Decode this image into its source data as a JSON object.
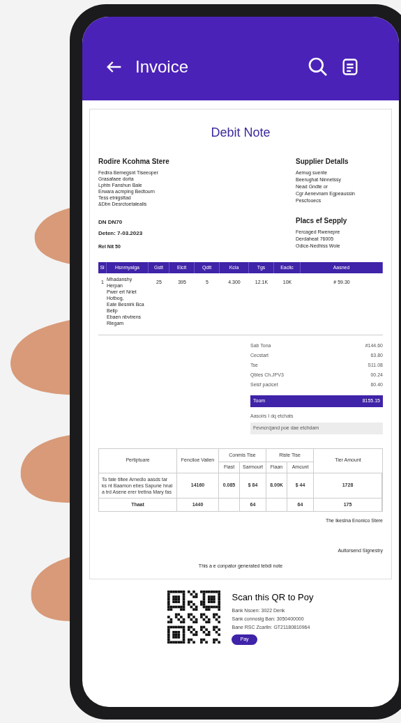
{
  "app_bar": {
    "title": "Invoice"
  },
  "document": {
    "title": "Debit Note",
    "buyer": {
      "name": "Rodire Kcohma Stere",
      "lines": [
        "Fedira Bemegsnt Tiseeoper",
        "Grasafaee dorta",
        "Lphtn Fanshun Bale",
        "Erwara acmping Bedtourn",
        "Tess etnigsttad",
        "&Dbn Desrctoetalealis"
      ]
    },
    "note_number": "DN DN70",
    "date": "Deten: 7-03.2023",
    "ref": "Rel Nit 50",
    "supplier": {
      "heading": "Supplier Detalls",
      "lines": [
        "Aemug suente",
        "Beerughat Ninnetssy",
        "Nead Gndte or",
        "Cgr Aenevnam Egpeaussin",
        "Pescfooecs"
      ]
    },
    "supply_place": {
      "heading": "Placs ef Sepply",
      "lines": [
        "Fercaged Rwenepre",
        "Derdaheat 76005",
        "Odice-Nedhiss Wole"
      ]
    },
    "items": {
      "columns": [
        "Sl",
        "Hsnmyalga",
        "Gstt",
        "Elcit",
        "Qdtt",
        "Kcia",
        "Tgs",
        "Eaclic",
        "Aasned"
      ],
      "rows": [
        {
          "cells": [
            "1",
            "",
            "25",
            "395",
            "5",
            "4.300",
            "12.1K",
            "10K",
            "# 59.30"
          ],
          "description": [
            "Mhadanshy",
            "Herpan",
            "Pwer ert Nriet",
            "Hotbog,",
            "Eate Besnirk Bca",
            "Bellp",
            "Ebaen nbvtrens",
            "Rlegam"
          ]
        }
      ]
    },
    "totals": [
      {
        "label": "Sab Tona",
        "value": "#144.60"
      },
      {
        "label": "Cecstart",
        "value": "63.80"
      },
      {
        "label": "Tse",
        "value": "S11.08"
      },
      {
        "label": "Qbles Ch.JPV3",
        "value": "00.24"
      },
      {
        "label": "Seisf pacicet",
        "value": "60.40"
      }
    ],
    "grand_total": {
      "label": "Toom",
      "value": "8155.15"
    },
    "amount_words_label": "Aasoirs I dq etchats",
    "amount_words": "Fevncrcjand poe dae etchdam",
    "tax_table": {
      "particulars": "Pertiptuare",
      "taxable": "Fenciloe Valien",
      "group_1": "Conmis Tise",
      "group_2": "Riste Tise",
      "sub": [
        "Fiast",
        "Sarmourt",
        "Fiaan",
        "Amcunt"
      ],
      "tax_amount": "Tier Amount",
      "row": [
        "To fate tiltee Arnedlo aasds tar ks nt Baamon ebes Sapune hnal a trd Asene erer tretina Mary fas",
        "14160",
        "0.085",
        "$ 84",
        "8.00K",
        "$ 44",
        "1728"
      ],
      "total": {
        "label": "Thaat",
        "value": "1440",
        "amount_1": "64",
        "amount_2": "64",
        "tax_amount": "175"
      }
    },
    "for_store": "The Ikeslna Enonico Stere",
    "signatory": "Aultorsend Signestry",
    "footer": "This a e conpator generated tebdi note"
  },
  "payment": {
    "title": "Scan this QR to Poy",
    "lines": [
      "Bank Nsoen:  3022 Denk",
      "Sank connoslg Ban: 3050400000",
      "Bane RSC Zcarlin: GT21180810964"
    ],
    "button": "Pay"
  }
}
